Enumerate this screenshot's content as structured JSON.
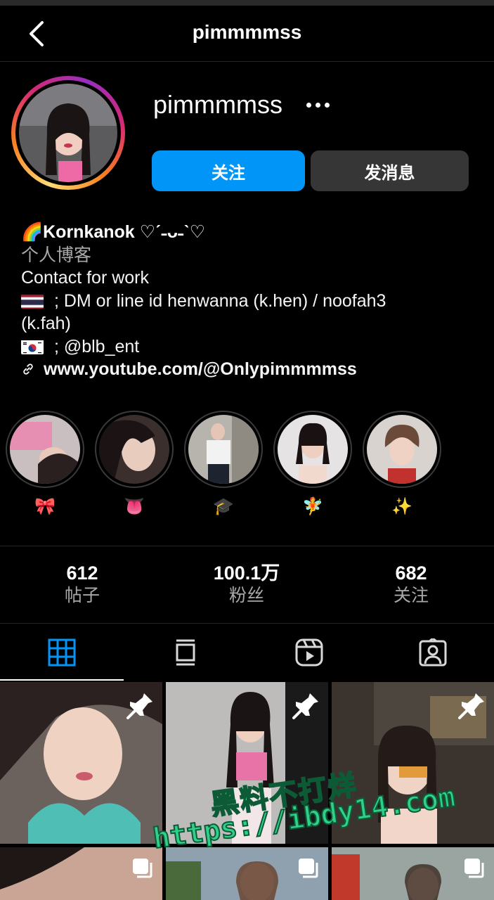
{
  "header": {
    "title": "pimmmmss"
  },
  "profile": {
    "username": "pimmmmss",
    "follow_label": "关注",
    "message_label": "发消息"
  },
  "bio": {
    "name": "🌈Kornkanok ♡ˊ˗ᴗ˗ˋ♡",
    "category": "个人博客",
    "line1": "Contact for work",
    "line2": " ; DM or line id henwanna (k.hen) / noofah3",
    "line3": "(k.fah)",
    "line4": " ; @blb_ent",
    "link": "www.youtube.com/@Onlypimmmmss"
  },
  "highlights": [
    {
      "label": "🎀"
    },
    {
      "label": "👅"
    },
    {
      "label": "🎓"
    },
    {
      "label": "🧚"
    },
    {
      "label": "✨"
    }
  ],
  "stats": [
    {
      "num": "612",
      "label": "帖子"
    },
    {
      "num": "100.1万",
      "label": "粉丝"
    },
    {
      "num": "682",
      "label": "关注"
    }
  ],
  "watermark": {
    "line1": "黑料不打烊",
    "line2": "https://ibdy14.com"
  },
  "colors": {
    "accent": "#0095f6",
    "secondary_button": "#363636",
    "muted_text": "#a8a8a8",
    "watermark": "#2fd08a"
  }
}
